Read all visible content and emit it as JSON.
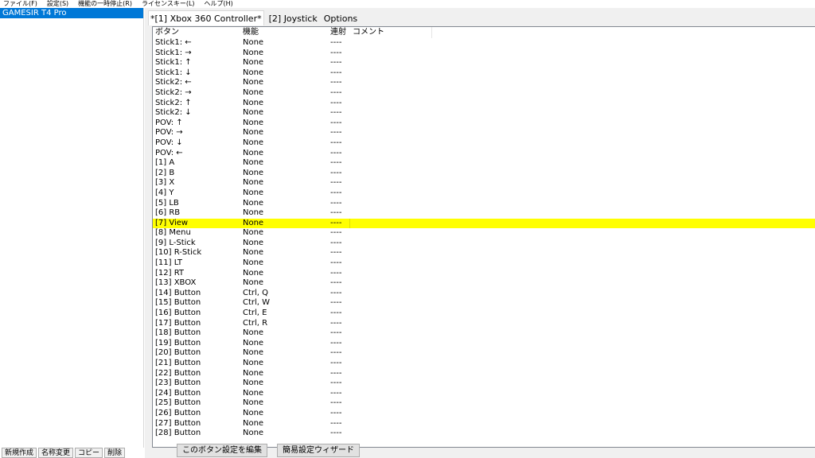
{
  "menu": {
    "items": [
      "ファイル(F)",
      "設定(S)",
      "機能の一時停止(R)",
      "ライセンスキー(L)",
      "ヘルプ(H)"
    ]
  },
  "sidebar": {
    "device": "GAMESIR T4 Pro",
    "buttons": [
      "新規作成",
      "名称変更",
      "コピー",
      "削除"
    ]
  },
  "tabs": [
    "*[1] Xbox 360 Controller*",
    "[2] Joystick",
    "Options"
  ],
  "table": {
    "headers": [
      "ボタン",
      "機能",
      "連射",
      "コメント"
    ],
    "rows": [
      {
        "button": "Stick1: ←",
        "func": "None",
        "rapid": "----"
      },
      {
        "button": "Stick1: →",
        "func": "None",
        "rapid": "----"
      },
      {
        "button": "Stick1: ↑",
        "func": "None",
        "rapid": "----"
      },
      {
        "button": "Stick1: ↓",
        "func": "None",
        "rapid": "----"
      },
      {
        "button": "Stick2: ←",
        "func": "None",
        "rapid": "----"
      },
      {
        "button": "Stick2: →",
        "func": "None",
        "rapid": "----"
      },
      {
        "button": "Stick2: ↑",
        "func": "None",
        "rapid": "----"
      },
      {
        "button": "Stick2: ↓",
        "func": "None",
        "rapid": "----"
      },
      {
        "button": "POV: ↑",
        "func": "None",
        "rapid": "----"
      },
      {
        "button": "POV: →",
        "func": "None",
        "rapid": "----"
      },
      {
        "button": "POV: ↓",
        "func": "None",
        "rapid": "----"
      },
      {
        "button": "POV: ←",
        "func": "None",
        "rapid": "----"
      },
      {
        "button": "[1] A",
        "func": "None",
        "rapid": "----"
      },
      {
        "button": "[2] B",
        "func": "None",
        "rapid": "----"
      },
      {
        "button": "[3] X",
        "func": "None",
        "rapid": "----"
      },
      {
        "button": "[4] Y",
        "func": "None",
        "rapid": "----"
      },
      {
        "button": "[5] LB",
        "func": "None",
        "rapid": "----"
      },
      {
        "button": "[6] RB",
        "func": "None",
        "rapid": "----"
      },
      {
        "button": "[7] View",
        "func": "None",
        "rapid": "----",
        "selected": true
      },
      {
        "button": "[8] Menu",
        "func": "None",
        "rapid": "----"
      },
      {
        "button": "[9] L-Stick",
        "func": "None",
        "rapid": "----"
      },
      {
        "button": "[10] R-Stick",
        "func": "None",
        "rapid": "----"
      },
      {
        "button": "[11] LT",
        "func": "None",
        "rapid": "----"
      },
      {
        "button": "[12] RT",
        "func": "None",
        "rapid": "----"
      },
      {
        "button": "[13] XBOX",
        "func": "None",
        "rapid": "----"
      },
      {
        "button": "[14] Button",
        "func": "Ctrl, Q",
        "rapid": "----"
      },
      {
        "button": "[15] Button",
        "func": "Ctrl, W",
        "rapid": "----"
      },
      {
        "button": "[16] Button",
        "func": "Ctrl, E",
        "rapid": "----"
      },
      {
        "button": "[17] Button",
        "func": "Ctrl, R",
        "rapid": "----"
      },
      {
        "button": "[18] Button",
        "func": "None",
        "rapid": "----"
      },
      {
        "button": "[19] Button",
        "func": "None",
        "rapid": "----"
      },
      {
        "button": "[20] Button",
        "func": "None",
        "rapid": "----"
      },
      {
        "button": "[21] Button",
        "func": "None",
        "rapid": "----"
      },
      {
        "button": "[22] Button",
        "func": "None",
        "rapid": "----"
      },
      {
        "button": "[23] Button",
        "func": "None",
        "rapid": "----"
      },
      {
        "button": "[24] Button",
        "func": "None",
        "rapid": "----"
      },
      {
        "button": "[25] Button",
        "func": "None",
        "rapid": "----"
      },
      {
        "button": "[26] Button",
        "func": "None",
        "rapid": "----"
      },
      {
        "button": "[27] Button",
        "func": "None",
        "rapid": "----"
      },
      {
        "button": "[28] Button",
        "func": "None",
        "rapid": "----"
      }
    ]
  },
  "actions": {
    "edit_label": "このボタン設定を編集",
    "wizard_label": "簡易設定ウィザード"
  },
  "colors": {
    "selection_blue": "#0078d7",
    "highlight_yellow": "#ffff00"
  }
}
